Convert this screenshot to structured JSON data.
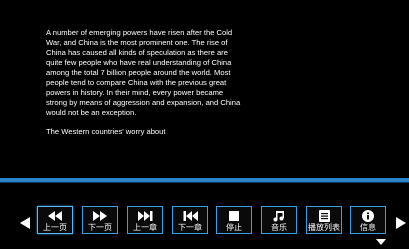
{
  "reader": {
    "paragraph_1": "A number of emerging powers have risen after the Cold War, and China is the most prominent one. The rise of China has caused all kinds of speculation as there are quite few people who have real understanding of China among the total 7 billion people around the world. Most people tend to compare China with the previous great powers in history. In their mind, every power became strong by means of aggression and expansion, and China would not be an exception.",
    "paragraph_2": "The Western countries' worry about"
  },
  "toolbar": {
    "buttons": [
      {
        "label": "上一页",
        "icon": "double-left-arrow-icon"
      },
      {
        "label": "下一页",
        "icon": "double-right-arrow-icon"
      },
      {
        "label": "上一章",
        "icon": "skip-next-icon"
      },
      {
        "label": "下一章",
        "icon": "skip-previous-icon"
      },
      {
        "label": "停止",
        "icon": "stop-icon"
      },
      {
        "label": "音乐",
        "icon": "music-note-icon"
      },
      {
        "label": "播放列表",
        "icon": "playlist-icon"
      },
      {
        "label": "信息",
        "icon": "info-icon"
      }
    ]
  },
  "colors": {
    "accent": "#2a86c8",
    "button_border": "#39a0e6",
    "background": "#000000",
    "text": "#ffffff"
  }
}
